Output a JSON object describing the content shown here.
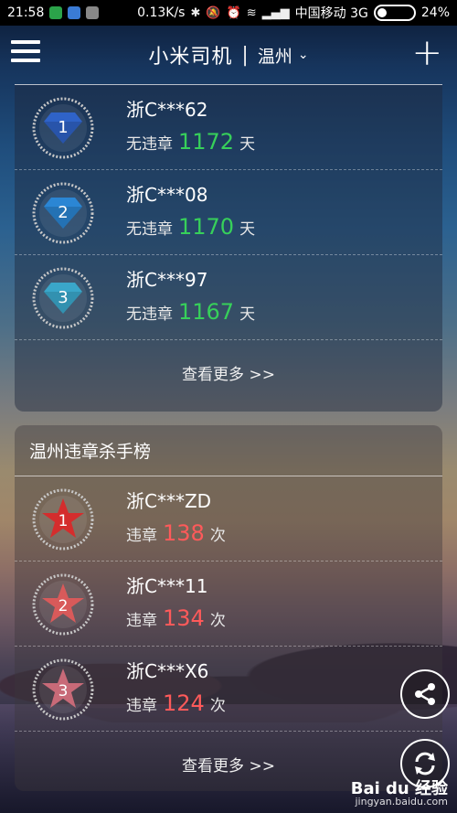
{
  "status_bar": {
    "time": "21:58",
    "net_speed": "0.13K/s",
    "carrier": "中国移动 3G",
    "battery": "24%"
  },
  "header": {
    "title": "小米司机",
    "separator": "|",
    "city": "温州",
    "chevron": "⌄",
    "plus": "+"
  },
  "good_drivers": {
    "items": [
      {
        "rank": "1",
        "plate": "浙C***62",
        "prefix": "无违章",
        "value": "1172",
        "suffix": "天",
        "color": "#2f63c8"
      },
      {
        "rank": "2",
        "plate": "浙C***08",
        "prefix": "无违章",
        "value": "1170",
        "suffix": "天",
        "color": "#2b86d4"
      },
      {
        "rank": "3",
        "plate": "浙C***97",
        "prefix": "无违章",
        "value": "1167",
        "suffix": "天",
        "color": "#3aa6c9"
      }
    ],
    "more": "查看更多 >>"
  },
  "violators": {
    "title": "温州违章杀手榜",
    "items": [
      {
        "rank": "1",
        "plate": "浙C***ZD",
        "prefix": "违章",
        "value": "138",
        "suffix": "次",
        "color": "#d42d2d"
      },
      {
        "rank": "2",
        "plate": "浙C***11",
        "prefix": "违章",
        "value": "134",
        "suffix": "次",
        "color": "#d85a5a"
      },
      {
        "rank": "3",
        "plate": "浙C***X6",
        "prefix": "违章",
        "value": "124",
        "suffix": "次",
        "color": "#c86a78"
      }
    ],
    "more": "查看更多 >>"
  },
  "watermark": {
    "brand": "Bai du 经验",
    "url": "jingyan.baidu.com"
  },
  "icons": {
    "menu": "hamburger-icon",
    "plus": "plus-icon",
    "share": "share-icon",
    "refresh": "refresh-icon",
    "diamond": "diamond-icon",
    "star": "star-icon"
  }
}
